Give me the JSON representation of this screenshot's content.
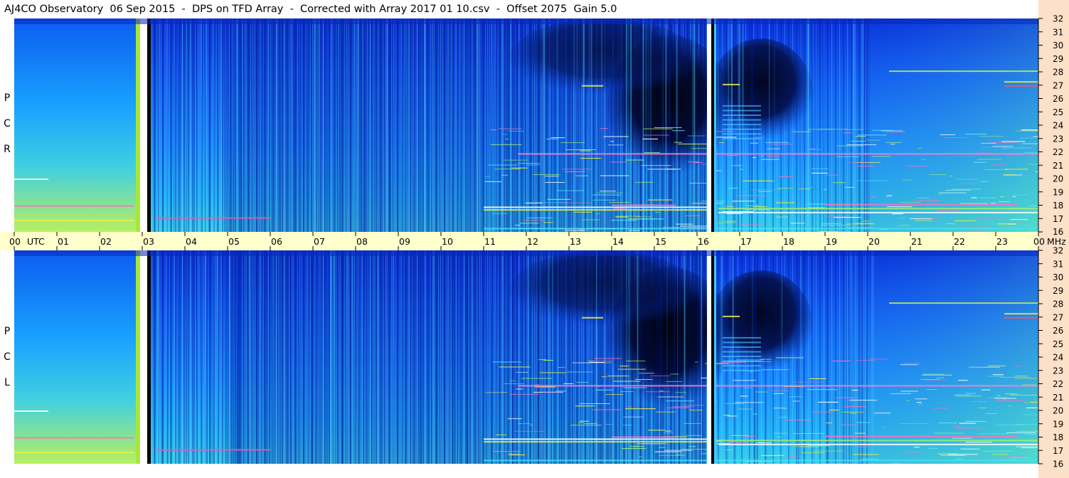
{
  "chart_data": {
    "type": "heatmap",
    "title": "AJ4CO Observatory  06 Sep 2015  -  DPS on TFD Array  -  Corrected with Array 2017 01 10.csv  -  Offset 2075  Gain 5.0",
    "panels": [
      {
        "name": "RCP",
        "letters": [
          "P",
          "C",
          "R"
        ]
      },
      {
        "name": "LCP",
        "letters": [
          "P",
          "C",
          "L"
        ]
      }
    ],
    "x_axis": {
      "unit_label": "UTC",
      "ticks": [
        "00",
        "01",
        "02",
        "03",
        "04",
        "05",
        "06",
        "07",
        "08",
        "09",
        "10",
        "11",
        "12",
        "13",
        "14",
        "15",
        "16",
        "17",
        "18",
        "19",
        "20",
        "21",
        "22",
        "23",
        "00"
      ],
      "range_hours": [
        0,
        24
      ]
    },
    "y_axis": {
      "unit_label": "MHz",
      "ticks": [
        "32",
        "31",
        "30",
        "29",
        "28",
        "27",
        "26",
        "25",
        "24",
        "23",
        "22",
        "21",
        "20",
        "19",
        "18",
        "17",
        "16"
      ],
      "range_mhz": [
        16,
        32
      ]
    },
    "gaps_hours": [
      3.0,
      16.3
    ],
    "colormap": [
      "#000822",
      "#001a6a",
      "#0030c8",
      "#1060ff",
      "#18a8ff",
      "#40d8e0",
      "#a0f070",
      "#f0f040",
      "#ff60c0",
      "#ffffff"
    ],
    "features": {
      "day_absorption": "stronger blue noise floor 05–16 UTC",
      "dark_region_hours": [
        14.5,
        16.2
      ],
      "dark_region_mhz": [
        22,
        29
      ],
      "rfi_bands_mhz": [
        17,
        17.8,
        18,
        27
      ]
    }
  }
}
